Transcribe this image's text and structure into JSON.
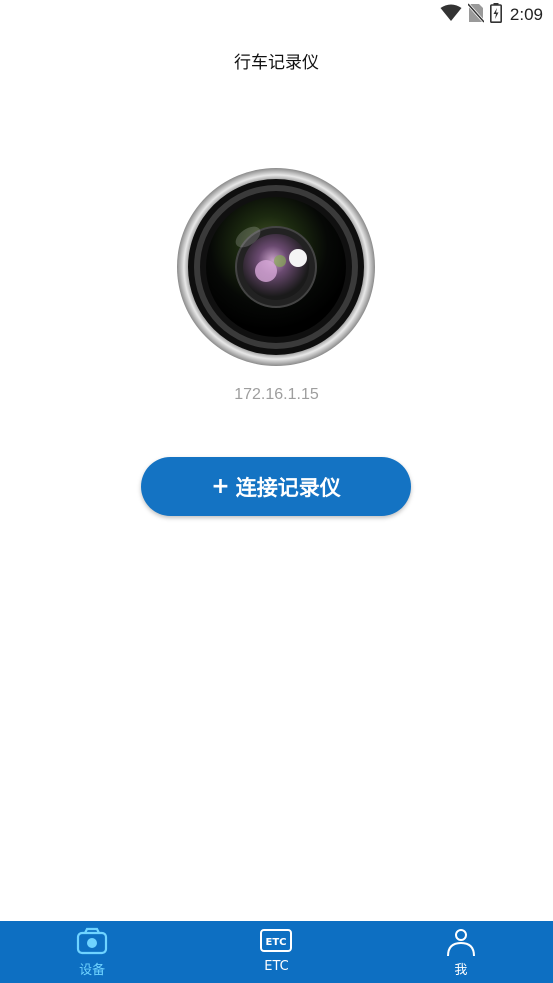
{
  "status_bar": {
    "time": "2:09",
    "icons": [
      "wifi-icon",
      "no-sim-icon",
      "battery-charging-icon"
    ]
  },
  "header": {
    "title": "行车记录仪"
  },
  "device": {
    "image": "camera-lens-icon",
    "ip": "172.16.1.15"
  },
  "connect_button": {
    "icon": "+",
    "label": "连接记录仪"
  },
  "tab_bar": {
    "items": [
      {
        "label": "设备",
        "icon": "camera-icon",
        "active": true
      },
      {
        "label": "ETC",
        "icon": "etc-icon",
        "active": false
      },
      {
        "label": "我",
        "icon": "person-icon",
        "active": false
      }
    ]
  },
  "colors": {
    "primary": "#1473c3",
    "tab_bar": "#0d6fc2",
    "tab_active": "#6fd3ff",
    "ip_text": "#9e9e9e"
  }
}
